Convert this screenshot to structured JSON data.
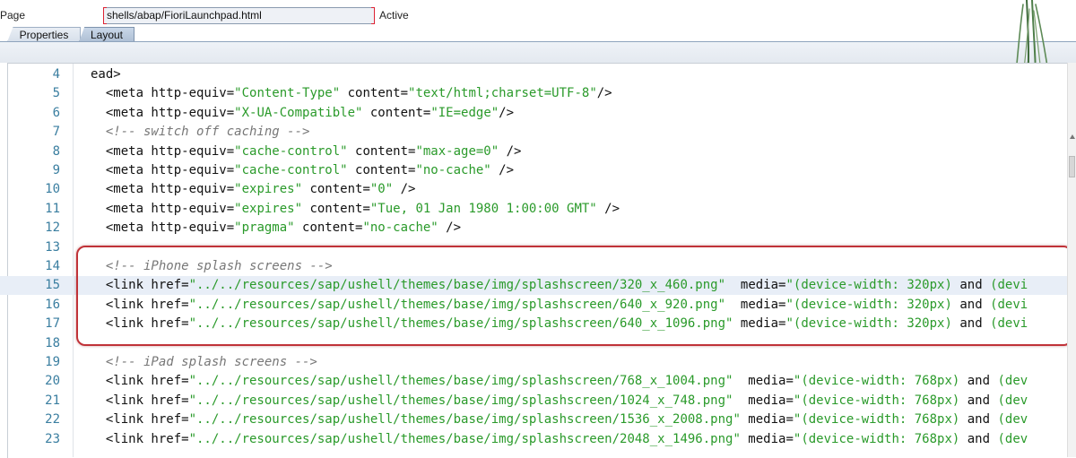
{
  "header": {
    "page_label": "Page",
    "page_value": "shells/abap/FioriLaunchpad.html",
    "status": "Active"
  },
  "tabs": [
    {
      "label": "Properties",
      "active": false
    },
    {
      "label": "Layout",
      "active": true
    }
  ],
  "editor": {
    "lines": [
      {
        "num": "4",
        "tokens": [
          {
            "t": "t",
            "v": "ead>"
          }
        ]
      },
      {
        "num": "5",
        "tokens": [
          {
            "t": "t",
            "v": "  <meta http-equiv="
          },
          {
            "t": "s",
            "v": "\"Content-Type\""
          },
          {
            "t": "t",
            "v": " content="
          },
          {
            "t": "s",
            "v": "\"text/html;charset=UTF-8\""
          },
          {
            "t": "t",
            "v": "/>"
          }
        ]
      },
      {
        "num": "6",
        "tokens": [
          {
            "t": "t",
            "v": "  <meta http-equiv="
          },
          {
            "t": "s",
            "v": "\"X-UA-Compatible\""
          },
          {
            "t": "t",
            "v": " content="
          },
          {
            "t": "s",
            "v": "\"IE=edge\""
          },
          {
            "t": "t",
            "v": "/>"
          }
        ]
      },
      {
        "num": "7",
        "tokens": [
          {
            "t": "c",
            "v": "  <!-- switch off caching -->"
          }
        ]
      },
      {
        "num": "8",
        "tokens": [
          {
            "t": "t",
            "v": "  <meta http-equiv="
          },
          {
            "t": "s",
            "v": "\"cache-control\""
          },
          {
            "t": "t",
            "v": " content="
          },
          {
            "t": "s",
            "v": "\"max-age=0\""
          },
          {
            "t": "t",
            "v": " />"
          }
        ]
      },
      {
        "num": "9",
        "tokens": [
          {
            "t": "t",
            "v": "  <meta http-equiv="
          },
          {
            "t": "s",
            "v": "\"cache-control\""
          },
          {
            "t": "t",
            "v": " content="
          },
          {
            "t": "s",
            "v": "\"no-cache\""
          },
          {
            "t": "t",
            "v": " />"
          }
        ]
      },
      {
        "num": "10",
        "tokens": [
          {
            "t": "t",
            "v": "  <meta http-equiv="
          },
          {
            "t": "s",
            "v": "\"expires\""
          },
          {
            "t": "t",
            "v": " content="
          },
          {
            "t": "s",
            "v": "\"0\""
          },
          {
            "t": "t",
            "v": " />"
          }
        ]
      },
      {
        "num": "11",
        "tokens": [
          {
            "t": "t",
            "v": "  <meta http-equiv="
          },
          {
            "t": "s",
            "v": "\"expires\""
          },
          {
            "t": "t",
            "v": " content="
          },
          {
            "t": "s",
            "v": "\"Tue, 01 Jan 1980 1:00:00 GMT\""
          },
          {
            "t": "t",
            "v": " />"
          }
        ]
      },
      {
        "num": "12",
        "tokens": [
          {
            "t": "t",
            "v": "  <meta http-equiv="
          },
          {
            "t": "s",
            "v": "\"pragma\""
          },
          {
            "t": "t",
            "v": " content="
          },
          {
            "t": "s",
            "v": "\"no-cache\""
          },
          {
            "t": "t",
            "v": " />"
          }
        ]
      },
      {
        "num": "13",
        "tokens": []
      },
      {
        "num": "14",
        "tokens": [
          {
            "t": "c",
            "v": "  <!-- iPhone splash screens -->"
          }
        ]
      },
      {
        "num": "15",
        "highlight": true,
        "tokens": [
          {
            "t": "t",
            "v": "  <link href="
          },
          {
            "t": "s",
            "v": "\"../../resources/sap/ushell/themes/base/img/splashscreen/320_x_460.png\""
          },
          {
            "t": "t",
            "v": "  media="
          },
          {
            "t": "s",
            "v": "\"(device-width: 320px)"
          },
          {
            "t": "t",
            "v": " and "
          },
          {
            "t": "s",
            "v": "(devi"
          }
        ]
      },
      {
        "num": "16",
        "tokens": [
          {
            "t": "t",
            "v": "  <link href="
          },
          {
            "t": "s",
            "v": "\"../../resources/sap/ushell/themes/base/img/splashscreen/640_x_920.png\""
          },
          {
            "t": "t",
            "v": "  media="
          },
          {
            "t": "s",
            "v": "\"(device-width: 320px)"
          },
          {
            "t": "t",
            "v": " and "
          },
          {
            "t": "s",
            "v": "(devi"
          }
        ]
      },
      {
        "num": "17",
        "tokens": [
          {
            "t": "t",
            "v": "  <link href="
          },
          {
            "t": "s",
            "v": "\"../../resources/sap/ushell/themes/base/img/splashscreen/640_x_1096.png\""
          },
          {
            "t": "t",
            "v": " media="
          },
          {
            "t": "s",
            "v": "\"(device-width: 320px)"
          },
          {
            "t": "t",
            "v": " and "
          },
          {
            "t": "s",
            "v": "(devi"
          }
        ]
      },
      {
        "num": "18",
        "tokens": []
      },
      {
        "num": "19",
        "tokens": [
          {
            "t": "c",
            "v": "  <!-- iPad splash screens -->"
          }
        ]
      },
      {
        "num": "20",
        "tokens": [
          {
            "t": "t",
            "v": "  <link href="
          },
          {
            "t": "s",
            "v": "\"../../resources/sap/ushell/themes/base/img/splashscreen/768_x_1004.png\""
          },
          {
            "t": "t",
            "v": "  media="
          },
          {
            "t": "s",
            "v": "\"(device-width: 768px)"
          },
          {
            "t": "t",
            "v": " and "
          },
          {
            "t": "s",
            "v": "(dev"
          }
        ]
      },
      {
        "num": "21",
        "tokens": [
          {
            "t": "t",
            "v": "  <link href="
          },
          {
            "t": "s",
            "v": "\"../../resources/sap/ushell/themes/base/img/splashscreen/1024_x_748.png\""
          },
          {
            "t": "t",
            "v": "  media="
          },
          {
            "t": "s",
            "v": "\"(device-width: 768px)"
          },
          {
            "t": "t",
            "v": " and "
          },
          {
            "t": "s",
            "v": "(dev"
          }
        ]
      },
      {
        "num": "22",
        "tokens": [
          {
            "t": "t",
            "v": "  <link href="
          },
          {
            "t": "s",
            "v": "\"../../resources/sap/ushell/themes/base/img/splashscreen/1536_x_2008.png\""
          },
          {
            "t": "t",
            "v": " media="
          },
          {
            "t": "s",
            "v": "\"(device-width: 768px)"
          },
          {
            "t": "t",
            "v": " and "
          },
          {
            "t": "s",
            "v": "(dev"
          }
        ]
      },
      {
        "num": "23",
        "tokens": [
          {
            "t": "t",
            "v": "  <link href="
          },
          {
            "t": "s",
            "v": "\"../../resources/sap/ushell/themes/base/img/splashscreen/2048_x_1496.png\""
          },
          {
            "t": "t",
            "v": " media="
          },
          {
            "t": "s",
            "v": "\"(device-width: 768px)"
          },
          {
            "t": "t",
            "v": " and "
          },
          {
            "t": "s",
            "v": "(dev"
          }
        ]
      }
    ]
  },
  "colors": {
    "string": "#2a9a2a",
    "comment": "#777777",
    "line_number": "#3a7ea0",
    "annotation_box": "#c03238",
    "active_tab": "#aebfd4"
  },
  "icons": [
    "plant-decoration-icon",
    "scroll-up-icon"
  ]
}
